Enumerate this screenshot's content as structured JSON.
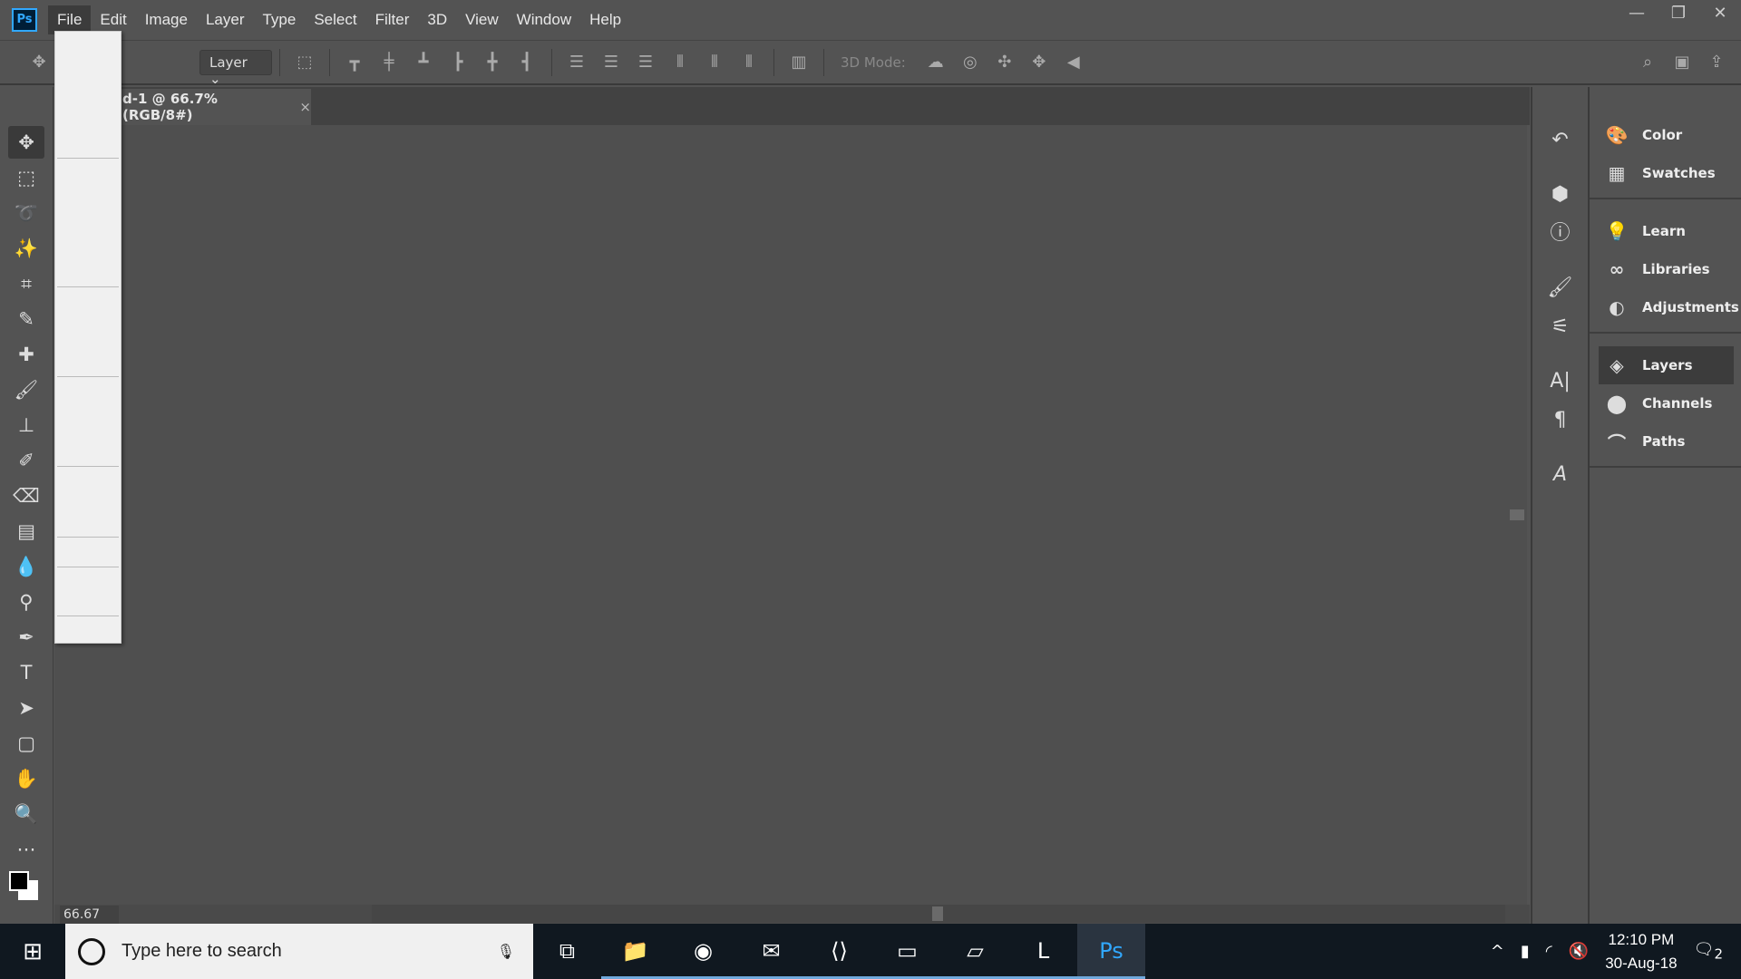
{
  "menubar": {
    "logo": "Ps",
    "items": [
      "File",
      "Edit",
      "Image",
      "Layer",
      "Type",
      "Select",
      "Filter",
      "3D",
      "View",
      "Window",
      "Help"
    ],
    "active": "File"
  },
  "window_controls": {
    "minimize": "—",
    "restore": "❐",
    "close": "✕"
  },
  "options": {
    "layer_select": "Layer",
    "mode_3d": "3D Mode:"
  },
  "document": {
    "tab_title": "d-1 @ 66.7% (RGB/8#)",
    "close": "×",
    "zoom": "66.67"
  },
  "panels": {
    "groups": [
      [
        "Color",
        "Swatches"
      ],
      [
        "Learn",
        "Libraries",
        "Adjustments"
      ],
      [
        "Layers",
        "Channels",
        "Paths"
      ]
    ],
    "selected": "Layers"
  },
  "taskbar": {
    "search_placeholder": "Type here to search",
    "time": "12:10 PM",
    "date": "30-Aug-18",
    "notifications": "2",
    "apps": [
      "task-view",
      "file-explorer",
      "chrome",
      "outlook",
      "vscode",
      "terminal",
      "notepad",
      "lync",
      "photoshop"
    ]
  },
  "colors": {
    "accent": "#31a8ff",
    "bg": "#535353"
  }
}
